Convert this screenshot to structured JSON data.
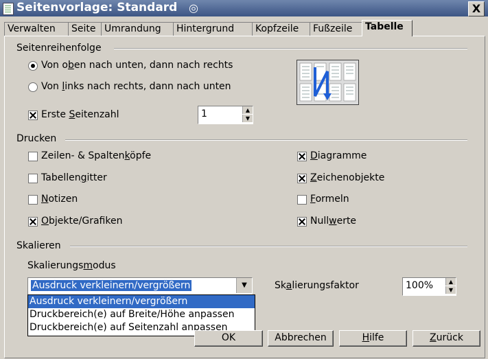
{
  "window": {
    "title": "Seitenvorlage: Standard",
    "close": "X"
  },
  "tabs": [
    {
      "label": "Verwalten"
    },
    {
      "label": "Seite"
    },
    {
      "label": "Umrandung"
    },
    {
      "label": "Hintergrund"
    },
    {
      "label": "Kopfzeile"
    },
    {
      "label": "Fußzeile"
    },
    {
      "label": "Tabelle"
    }
  ],
  "page_order": {
    "heading": "Seitenreihenfolge",
    "option1": {
      "pre": "Von o",
      "acc": "b",
      "post": "en nach unten, dann nach rechts",
      "selected": true
    },
    "option2": {
      "pre": "Von ",
      "acc": "l",
      "post": "inks nach rechts, dann nach unten",
      "selected": false
    },
    "first_page": {
      "pre": "Erste ",
      "acc": "S",
      "post": "eitenzahl",
      "checked": true,
      "value": "1"
    }
  },
  "print": {
    "heading": "Drucken",
    "left": [
      {
        "pre": "Zeilen- & Spalten",
        "acc": "k",
        "post": "öpfe",
        "checked": false
      },
      {
        "pre": "Tabellen",
        "acc": "g",
        "post": "itter",
        "checked": false
      },
      {
        "pre": "",
        "acc": "N",
        "post": "otizen",
        "checked": false
      },
      {
        "pre": "",
        "acc": "O",
        "post": "bjekte/Grafiken",
        "checked": true
      }
    ],
    "right": [
      {
        "pre": "",
        "acc": "D",
        "post": "iagramme",
        "checked": true
      },
      {
        "pre": "",
        "acc": "Z",
        "post": "eichenobjekte",
        "checked": true
      },
      {
        "pre": "",
        "acc": "F",
        "post": "ormeln",
        "checked": false
      },
      {
        "pre": "Null",
        "acc": "w",
        "post": "erte",
        "checked": true
      }
    ]
  },
  "scale": {
    "heading": "Skalieren",
    "mode_label_pre": "Skalierungs",
    "mode_label_acc": "m",
    "mode_label_post": "odus",
    "selected": "Ausdruck verkleinern/vergrößern",
    "options": [
      "Ausdruck verkleinern/vergrößern",
      "Druckbereich(e) auf Breite/Höhe anpassen",
      "Druckbereich(e) auf Seitenzahl anpassen"
    ],
    "factor_label_pre": "Sk",
    "factor_label_acc": "a",
    "factor_label_post": "lierungsfaktor",
    "factor_value": "100%"
  },
  "buttons": {
    "ok": "OK",
    "cancel": "Abbrechen",
    "help_acc": "H",
    "help_post": "ilfe",
    "back_acc": "Z",
    "back_post": "urück"
  },
  "colors": {
    "titlebar": "#3c5584",
    "selection": "#316ac5",
    "preview_arrow": "#1f5fd6"
  }
}
